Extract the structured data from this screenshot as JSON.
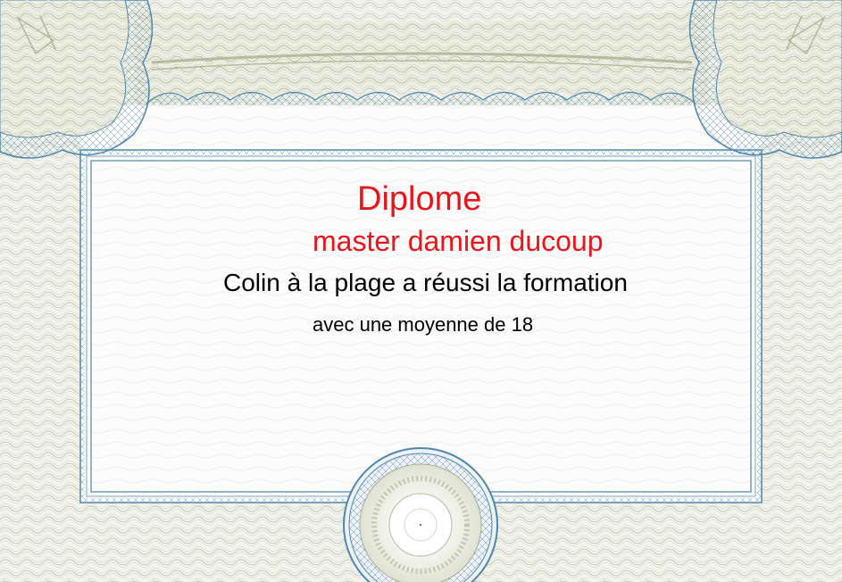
{
  "certificate": {
    "title": "Diplome",
    "recipient": "master damien ducoup",
    "statement": "Colin à la plage a réussi la formation",
    "average_line": "avec une moyenne de 18"
  },
  "colors": {
    "accent_text": "#e8151b",
    "guilloche_olive": "#a9ad8e",
    "guilloche_blue": "#4e86ad",
    "panel_background": "#fbfcfb"
  }
}
